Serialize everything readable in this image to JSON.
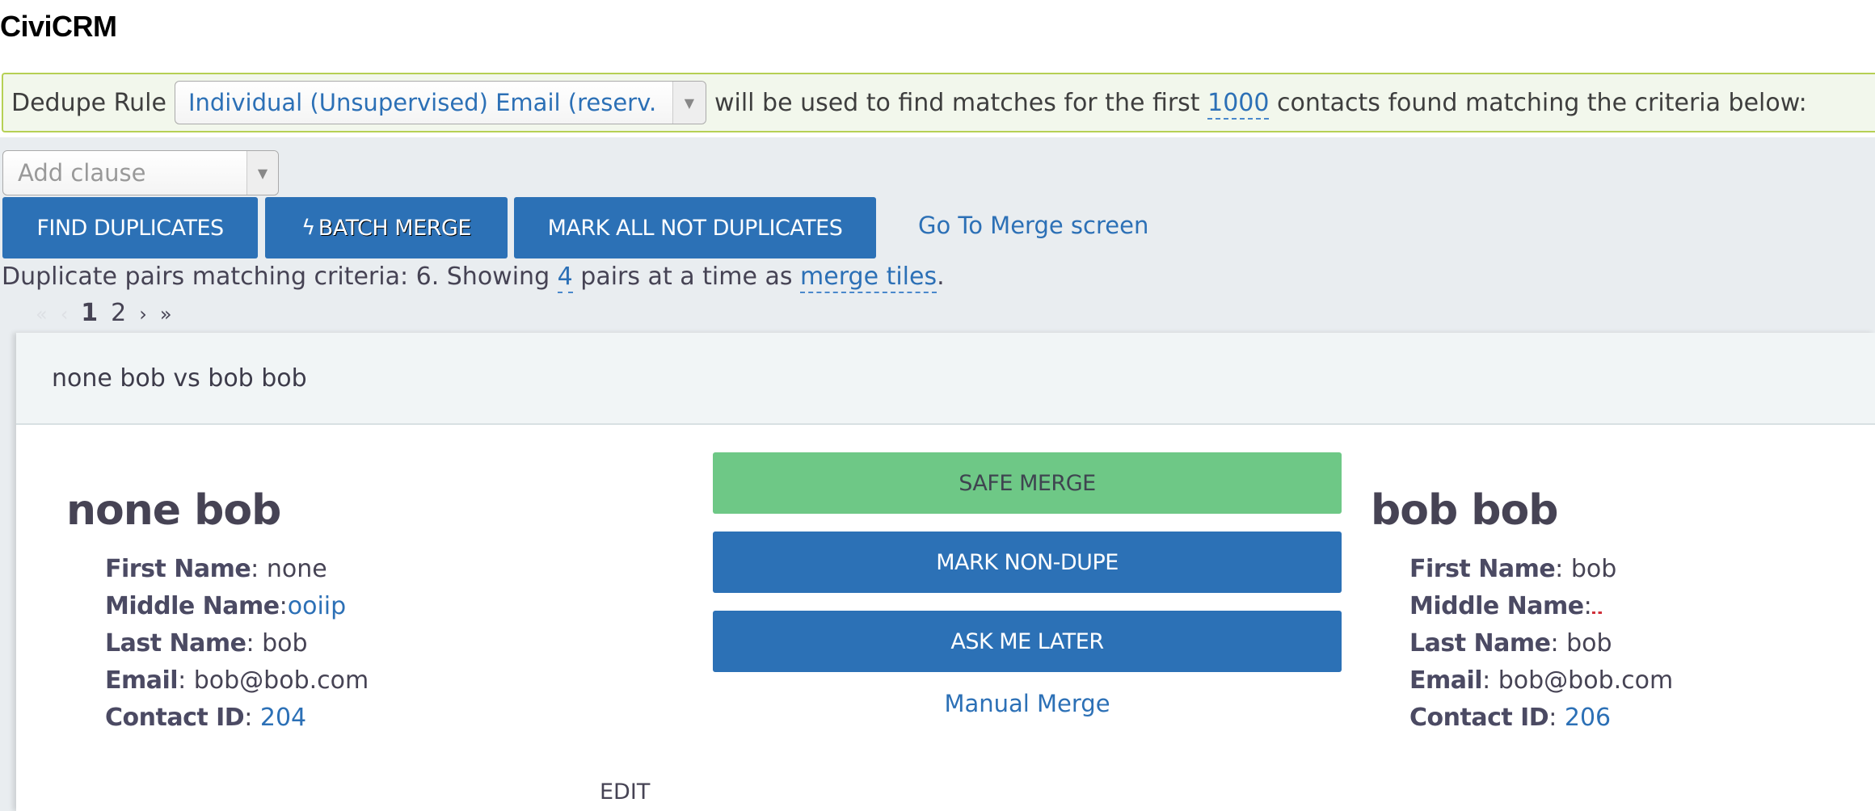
{
  "app": {
    "title": "CiviCRM"
  },
  "dedupe": {
    "label": "Dedupe Rule",
    "selected_rule": "Individual (Unsupervised) Email (reserv...",
    "text_before_limit": "will be used to find matches for the first",
    "limit": "1000",
    "text_after_limit": "contacts found matching the criteria below:"
  },
  "criteria": {
    "add_clause_placeholder": "Add clause"
  },
  "toolbar": {
    "find_duplicates": "FIND DUPLICATES",
    "batch_merge": "BATCH MERGE",
    "mark_all_not_duplicates": "MARK ALL NOT DUPLICATES",
    "go_to_merge_screen": "Go To Merge screen"
  },
  "summary": {
    "prefix": "Duplicate pairs matching criteria: 6. Showing",
    "page_size": "4",
    "middle": "pairs at a time as",
    "view_mode": "merge tiles",
    "suffix": "."
  },
  "pager": {
    "first": "«",
    "prev": "‹",
    "pages": [
      "1",
      "2"
    ],
    "current_page": "1",
    "next": "›",
    "last": "»"
  },
  "tile": {
    "title": "none bob vs bob bob",
    "left_contact": {
      "name": "none bob",
      "fields": [
        {
          "label": "First Name",
          "value": "none"
        },
        {
          "label": "Middle Name",
          "value": "ooiip"
        },
        {
          "label": "Last Name",
          "value": "bob"
        },
        {
          "label": "Email",
          "value": "bob@bob.com"
        },
        {
          "label": "Contact ID",
          "value": "204"
        }
      ]
    },
    "right_contact": {
      "name": "bob bob",
      "fields": [
        {
          "label": "First Name",
          "value": "bob"
        },
        {
          "label": "Middle Name",
          "value": ""
        },
        {
          "label": "Last Name",
          "value": "bob"
        },
        {
          "label": "Email",
          "value": "bob@bob.com"
        },
        {
          "label": "Contact ID",
          "value": "206"
        }
      ]
    },
    "actions": {
      "safe_merge": "SAFE MERGE",
      "mark_non_dupe": "MARK NON-DUPE",
      "ask_me_later": "ASK ME LATER",
      "manual_merge": "Manual Merge"
    },
    "edit_label": "EDIT"
  },
  "colors": {
    "primary": "#2c71b6",
    "safe_merge": "#6ec886",
    "link": "#2c70b6",
    "dedupe_border": "#b6d054",
    "empty_marker": "#d0303a"
  }
}
